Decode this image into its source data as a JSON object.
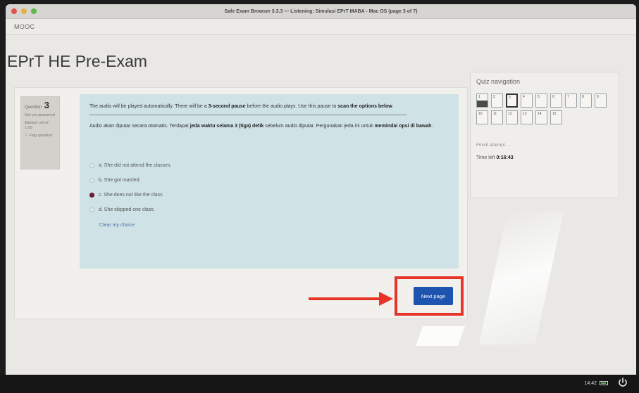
{
  "window": {
    "title": "Safe Exam Browser 3.3.3 — Listening: Simulasi EPrT MABA - Mac OS (page 3 of 7)"
  },
  "site": {
    "name": "MOOC"
  },
  "page": {
    "title": "EPrT HE Pre-Exam"
  },
  "question": {
    "label": "Question",
    "number": "3",
    "status": "Not yet answered",
    "marks": "Marked out of 1.00",
    "flag": "Flag question"
  },
  "instruction_en": {
    "part1": "The audio will be played automatically. There will be a ",
    "bold1": "3-second pause",
    "part2": " before the audio plays. Use this pause to ",
    "bold2": "scan the options below",
    "part3": "."
  },
  "instruction_id": {
    "part1": "Audio akan diputar secara otomatis. Terdapat ",
    "bold1": "jeda waktu selama 3 (tiga) detik",
    "part2": " sebelum audio diputar. Pergunakan jeda ini untuk ",
    "bold2": "memindai opsi di bawah",
    "part3": "."
  },
  "answers": [
    {
      "text": "a. She did not attend the classes.",
      "selected": false
    },
    {
      "text": "b. She got married.",
      "selected": false
    },
    {
      "text": "c. She does not like the class.",
      "selected": true
    },
    {
      "text": "d. She skipped one class.",
      "selected": false
    }
  ],
  "clear_choice": "Clear my choice",
  "next_button": "Next page",
  "quiz_nav": {
    "title": "Quiz navigation",
    "cells": [
      "1",
      "2",
      "3",
      "4",
      "5",
      "6",
      "7",
      "8",
      "9",
      "10",
      "11",
      "12",
      "13",
      "14",
      "15"
    ],
    "answered": [
      "1"
    ],
    "current": "3",
    "finish": "Finish attempt ...",
    "time_label": "Time left",
    "time_value": "0:16:43"
  },
  "taskbar": {
    "clock": "14:42"
  },
  "colors": {
    "accent": "#1c54b0",
    "annotation": "#e83428",
    "selected_radio": "#7a1a3a"
  }
}
